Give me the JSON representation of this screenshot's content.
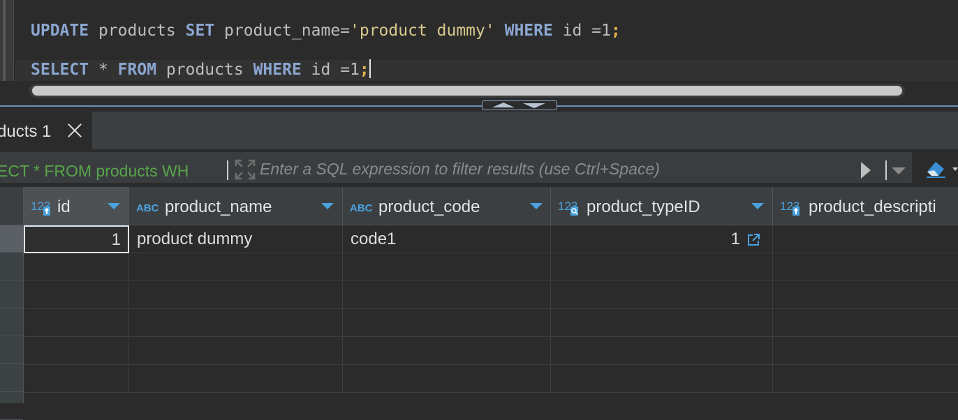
{
  "editor": {
    "line1": {
      "kw_update": "UPDATE",
      "table": "products",
      "kw_set": "SET",
      "assign": "product_name=",
      "value": "'product dummy'",
      "kw_where": "WHERE",
      "cond": "id =1",
      "semi": ";"
    },
    "line2": {
      "kw_select": "SELECT",
      "star": "*",
      "kw_from": "FROM",
      "table": "products",
      "kw_where": "WHERE",
      "cond": "id =1",
      "semi": ";"
    }
  },
  "results_tab": {
    "label": "ducts 1"
  },
  "filter": {
    "query_preview": "ECT * FROM products WH",
    "placeholder": "Enter a SQL expression to filter results (use Ctrl+Space)"
  },
  "grid": {
    "columns": [
      {
        "name": "id",
        "type_icon": "numeric-key-icon"
      },
      {
        "name": "product_name",
        "type_icon": "text-icon"
      },
      {
        "name": "product_code",
        "type_icon": "text-icon"
      },
      {
        "name": "product_typeID",
        "type_icon": "numeric-fk-icon"
      },
      {
        "name": "product_descripti",
        "type_icon": "numeric-key-icon"
      }
    ],
    "rows": [
      {
        "id": "1",
        "product_name": "product dummy",
        "product_code": "code1",
        "product_typeID": "1",
        "product_descripti": ""
      }
    ]
  },
  "colors": {
    "keyword": "#8ba6d0",
    "string": "#d6c98b",
    "semicolon": "#e0b34a",
    "filter_sql": "#57a64a",
    "accent": "#4aa3df"
  }
}
